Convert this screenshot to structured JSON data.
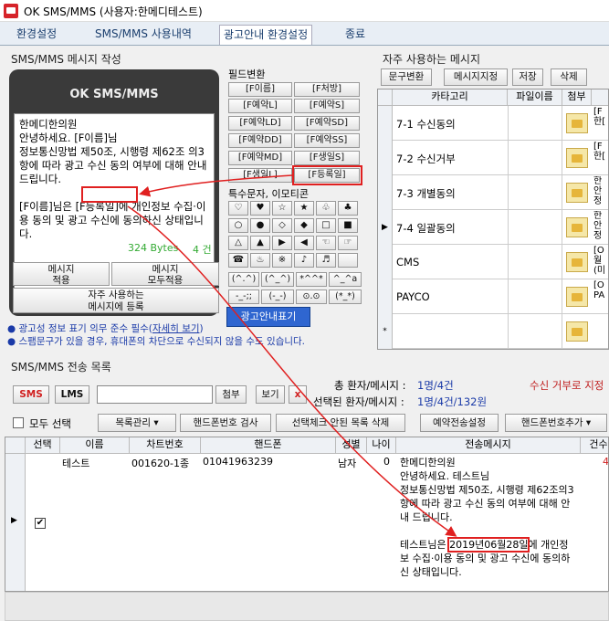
{
  "window": {
    "title": "OK SMS/MMS (사용자:한메디테스트)"
  },
  "tabs": [
    "환경설정",
    "SMS/MMS 사용내역",
    "광고안내 환경설정",
    "종료"
  ],
  "compose": {
    "section_title": "SMS/MMS 메시지 작성",
    "phone_header": "OK SMS/MMS",
    "message": "한메디한의원\n안녕하세요. [F이름]님\n정보통신망법 제50조, 시행령 제62조 의3항에 따라 광고 수신 동의 여부에 대해 안내 드립니다.\n\n[F이름]님은 [F등록일]에 개인정보 수집·이용 동의 및 광고 수신에 동의하신 상태입니다.",
    "bytes_label": "324 Bytes",
    "count_label": "4  건",
    "btn_apply": "메시지\n적용",
    "btn_apply_all": "메시지\n모두적용",
    "btn_register": "자주 사용하는\n메시지에 등록"
  },
  "fields": {
    "title": "필드변환",
    "buttons": [
      "[F이름]",
      "[F처방]",
      "[F예약L]",
      "[F예약S]",
      "[F예약LD]",
      "[F예약SD]",
      "[F예약DD]",
      "[F예약SS]",
      "[F예약MD]",
      "[F생일S]",
      "[F생일L]",
      "[F등록일]"
    ]
  },
  "specials": {
    "title": "특수문자, 이모티콘",
    "symbols": [
      "♡",
      "♥",
      "☆",
      "★",
      "♧",
      "♣",
      "○",
      "●",
      "◇",
      "◆",
      "□",
      "■",
      "△",
      "▲",
      "▶",
      "◀",
      "☜",
      "☞",
      "☎",
      "♨",
      "※",
      "♪",
      "♬",
      ""
    ],
    "emoticons": [
      "(^.^)",
      "(^_^)",
      "*^^*",
      "^_^a",
      "-_-;;",
      "(-_-)",
      "⊙.⊙",
      "(*_*)"
    ]
  },
  "ad_button": "광고안내표기",
  "notes": {
    "line1_a": "● 광고성 정보 표기 의무 준수 필수(",
    "line1_link": "자세히 보기",
    "line1_b": ")",
    "line2": "● 스팸문구가 있을 경우, 휴대폰의 차단으로 수신되지 않을 수도 있습니다."
  },
  "favorites": {
    "title": "자주 사용하는 메시지",
    "buttons": [
      "문구변환",
      "메시지지정",
      "저장",
      "삭제"
    ],
    "columns": [
      "카타고리",
      "파일이름",
      "첨부"
    ],
    "rows": [
      {
        "category": "7-1 수신동의",
        "preview": "[F\n한[",
        "selected": false
      },
      {
        "category": "7-2 수신거부",
        "preview": "[F\n한[",
        "selected": false
      },
      {
        "category": "7-3 개별동의",
        "preview": "한\n안\n정",
        "selected": false
      },
      {
        "category": "7-4 일괄동의",
        "preview": "한\n안\n정",
        "selected": true
      },
      {
        "category": "CMS",
        "preview": "[O\n월\n(미",
        "selected": false
      },
      {
        "category": "PAYCO",
        "preview": "[O\nPA",
        "selected": false
      },
      {
        "category": "",
        "preview": "",
        "selected": false
      }
    ],
    "new_row_marker": "*"
  },
  "send": {
    "section_title": "SMS/MMS 전송 목록",
    "total_label": "총 환자/메시지 :",
    "total_value": "1명/4건",
    "selected_label": "선택된 환자/메시지 :",
    "selected_value": "1명/4건/132원",
    "refuse_label": "수신 거부로 지정",
    "sms_button": "SMS",
    "lms_button": "LMS",
    "search_placeholder": "",
    "attach_button": "첨부",
    "view_button": "보기",
    "close_button": "x",
    "select_all": "모두 선택",
    "toolbar": [
      "목록관리",
      "핸드폰번호 검사",
      "선택체크 안된 목록 삭제",
      "예약전송설정",
      "핸드폰번호추가"
    ],
    "columns": [
      "선택",
      "이름",
      "차트번호",
      "핸드폰",
      "성별",
      "나이",
      "전송메시지",
      "건수"
    ],
    "row": {
      "checked": true,
      "name": "테스트",
      "chart_no": "001620-1종",
      "phone": "01041963239",
      "gender": "남자",
      "age": "0",
      "message_a": "한메디한의원\n안녕하세요. 테스트님\n정보통신망법 제50조, 시행령 제62조의3항에 따라 광고 수신 동의 여부에 대해 안내 드립니다.\n\n테스트님은 ",
      "message_date": "2019년06월28일",
      "message_b": "에 개인정보 수집·이용 동의 및 광고 수신에 동의하신 상태입니다.\n\n동의 여부를 변경하시고자 하는...",
      "count": "4"
    }
  },
  "colors": {
    "accent_blue": "#2f66d0",
    "highlight_red": "#e02020",
    "link_blue": "#1a3aa8"
  }
}
